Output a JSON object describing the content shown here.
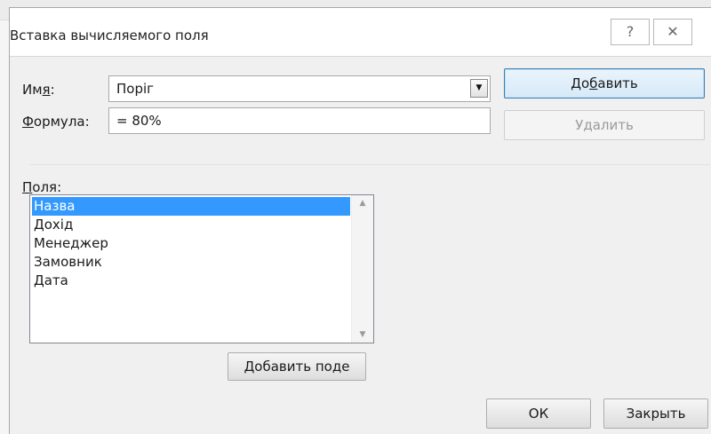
{
  "dialog": {
    "title": "Вставка вычисляемого поля",
    "help_icon": "?",
    "close_icon": "✕"
  },
  "form": {
    "name_label_pre": "Им",
    "name_label_acc": "я",
    "name_label_post": ":",
    "name_value": "Поріг",
    "formula_label_acc": "Ф",
    "formula_label_post": "ормула:",
    "formula_value": "= 80%"
  },
  "buttons": {
    "add_pre": "До",
    "add_acc": "б",
    "add_post": "авить",
    "delete": "Удалить",
    "insert_field_pre": "Добавить по",
    "insert_field_acc": "д",
    "insert_field_post": "е",
    "ok": "ОК",
    "close": "Закрыть"
  },
  "fields": {
    "label_acc": "П",
    "label_post": "оля:",
    "items": [
      "Назва",
      "Дохід",
      "Менеджер",
      "Замовник",
      "Дата"
    ],
    "selected_index": 0
  },
  "colors": {
    "selection": "#3399ff",
    "primary_border": "#3c7fb1"
  }
}
